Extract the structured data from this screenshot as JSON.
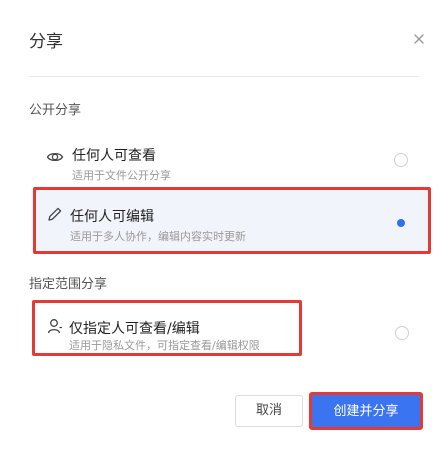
{
  "dialog": {
    "title": "分享",
    "close_icon": "close-icon"
  },
  "sections": {
    "public_label": "公开分享",
    "scope_label": "指定范围分享"
  },
  "options": [
    {
      "icon": "eye-icon",
      "title": "任何人可查看",
      "subtitle": "适用于文件公开分享",
      "selected": false
    },
    {
      "icon": "pencil-icon",
      "title": "任何人可编辑",
      "subtitle": "适用于多人协作，编辑内容实时更新",
      "selected": true
    },
    {
      "icon": "user-icon",
      "title": "仅指定人可查看/编辑",
      "subtitle": "适用于隐私文件，可指定查看/编辑权限",
      "selected": false
    }
  ],
  "buttons": {
    "cancel": "取消",
    "create": "创建并分享"
  },
  "colors": {
    "accent": "#3b74f1",
    "radio_selected": "#2f6ff0",
    "highlight": "#e53935",
    "selected_bg": "#f1f4fb"
  }
}
